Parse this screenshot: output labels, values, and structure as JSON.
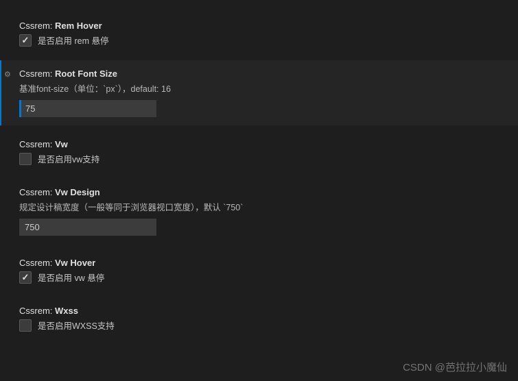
{
  "settings": {
    "remHover": {
      "prefix": "Cssrem: ",
      "name": "Rem Hover",
      "checkboxLabel": "是否启用 rem 悬停",
      "checked": true
    },
    "rootFontSize": {
      "prefix": "Cssrem: ",
      "name": "Root Font Size",
      "description": "基准font-size（单位：`px`），default: 16",
      "value": "75"
    },
    "vw": {
      "prefix": "Cssrem: ",
      "name": "Vw",
      "checkboxLabel": "是否启用vw支持",
      "checked": false
    },
    "vwDesign": {
      "prefix": "Cssrem: ",
      "name": "Vw Design",
      "description": "规定设计稿宽度（一般等同于浏览器视口宽度），默认 `750`",
      "value": "750"
    },
    "vwHover": {
      "prefix": "Cssrem: ",
      "name": "Vw Hover",
      "checkboxLabel": "是否启用 vw 悬停",
      "checked": true
    },
    "wxss": {
      "prefix": "Cssrem: ",
      "name": "Wxss",
      "checkboxLabel": "是否启用WXSS支持",
      "checked": false
    }
  },
  "watermark": "CSDN @芭拉拉小魔仙"
}
